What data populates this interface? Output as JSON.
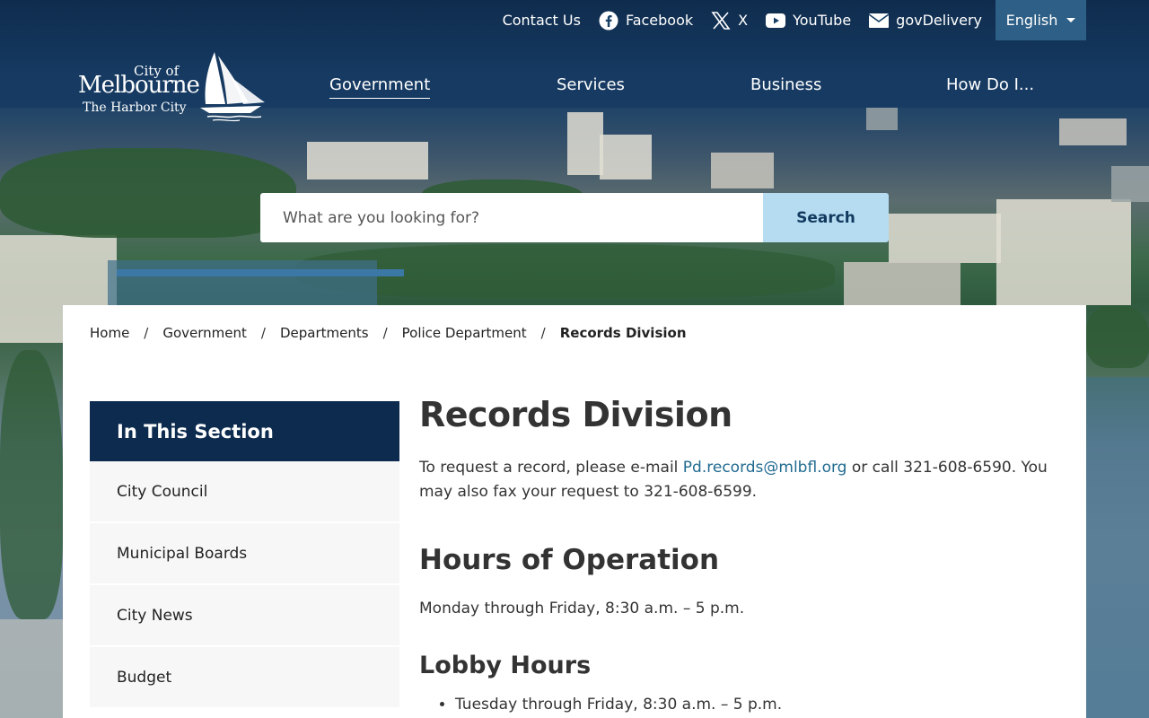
{
  "utility": {
    "contact": "Contact Us",
    "facebook": "Facebook",
    "x": "X",
    "youtube": "YouTube",
    "govdelivery": "govDelivery",
    "language": "English"
  },
  "logo": {
    "line1": "City of",
    "line2": "Melbourne",
    "line3": "The Harbor City"
  },
  "nav": {
    "items": [
      {
        "label": "Government",
        "active": true
      },
      {
        "label": "Services"
      },
      {
        "label": "Business"
      },
      {
        "label": "How Do I..."
      }
    ]
  },
  "search": {
    "placeholder": "What are you looking for?",
    "button": "Search"
  },
  "breadcrumb": {
    "items": [
      "Home",
      "Government",
      "Departments",
      "Police Department",
      "Records Division"
    ],
    "separator": "/"
  },
  "sidebar": {
    "heading": "In This Section",
    "items": [
      "City Council",
      "Municipal Boards",
      "City News",
      "Budget"
    ]
  },
  "content": {
    "title": "Records Division",
    "intro_before": "To request a record, please e-mail ",
    "email": "Pd.records@mlbfl.org",
    "intro_after": " or call 321-608-6590. You may also fax your request to 321-608-6599.",
    "hours_heading": "Hours of Operation",
    "hours_text": "Monday through Friday, 8:30 a.m. – 5 p.m.",
    "lobby_heading": "Lobby Hours",
    "lobby_items": [
      "Tuesday through Friday, 8:30 a.m. – 5 p.m."
    ]
  },
  "colors": {
    "navy": "#0d2b4f",
    "search_button": "#b6dcf2",
    "link": "#1f6a8f",
    "language_button": "#2e5f86"
  }
}
